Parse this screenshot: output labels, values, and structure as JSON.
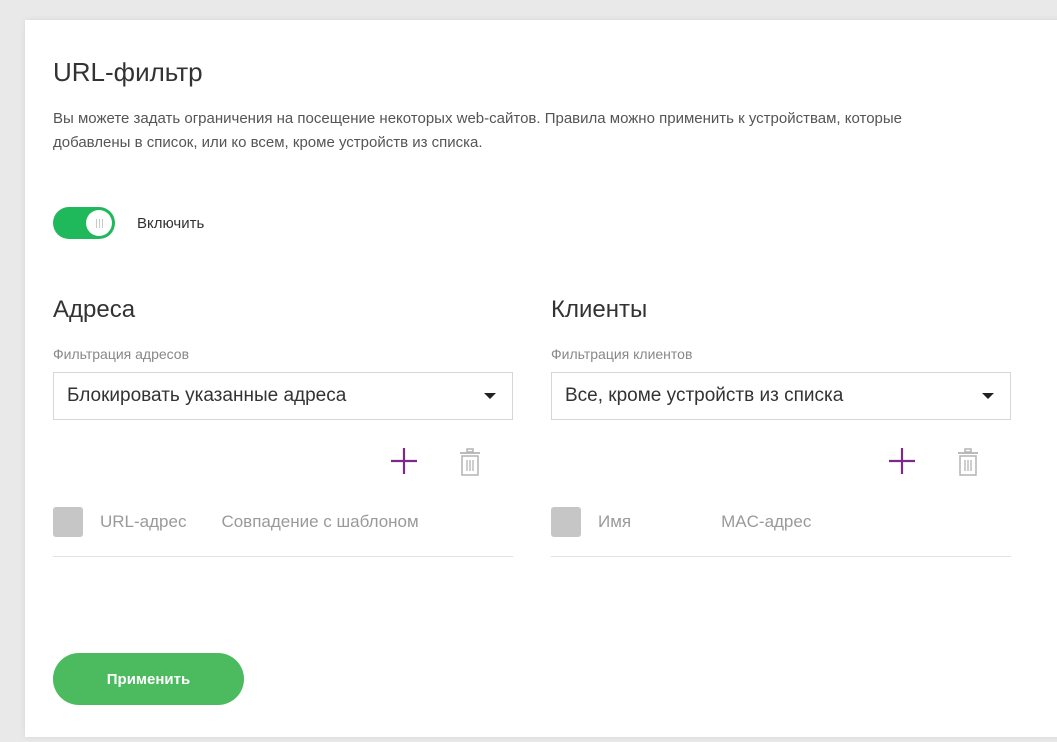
{
  "page": {
    "title": "URL-фильтр",
    "description": "Вы можете задать ограничения на посещение некоторых web-сайтов. Правила можно применить к устройствам, которые добавлены в список, или ко всем, кроме устройств из списка."
  },
  "toggle": {
    "label": "Включить",
    "enabled": true
  },
  "addresses": {
    "title": "Адреса",
    "filter_label": "Фильтрация адресов",
    "filter_value": "Блокировать указанные адреса",
    "columns": [
      "URL-адрес",
      "Совпадение с шаблоном"
    ]
  },
  "clients": {
    "title": "Клиенты",
    "filter_label": "Фильтрация клиентов",
    "filter_value": "Все, кроме устройств из списка",
    "columns": [
      "Имя",
      "MAC-адрес"
    ]
  },
  "apply_label": "Применить",
  "icons": {
    "add": "plus-icon",
    "delete": "trash-icon",
    "dropdown": "caret-down-icon"
  },
  "colors": {
    "toggle_on": "#1fb85a",
    "accent_purple": "#7b2a8c",
    "apply_button": "#4cba5e"
  }
}
